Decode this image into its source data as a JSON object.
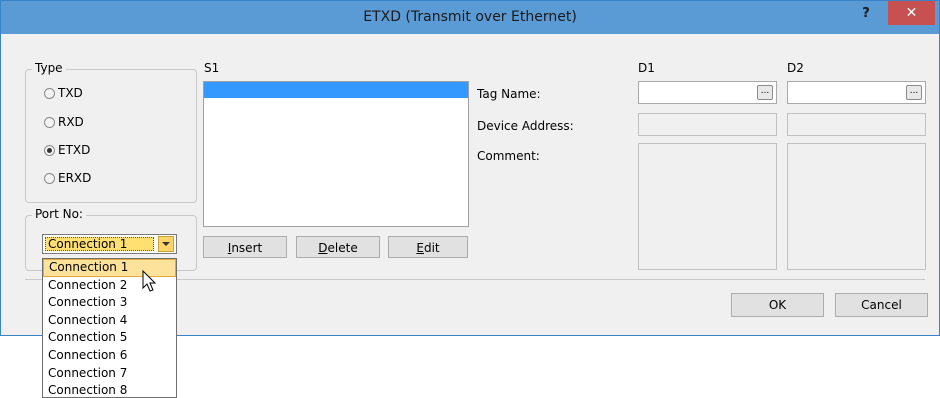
{
  "title": "ETXD (Transmit over Ethernet)",
  "help_label": "?",
  "close_label": "✕",
  "type_group": {
    "label": "Type",
    "options": [
      "TXD",
      "RXD",
      "ETXD",
      "ERXD"
    ],
    "selected": "ETXD"
  },
  "port_group": {
    "label": "Port No:",
    "selected": "Connection 1"
  },
  "s1": {
    "label": "S1"
  },
  "buttons": {
    "insert_key": "I",
    "insert_rest": "nsert",
    "delete_key": "D",
    "delete_rest": "elete",
    "edit_key": "E",
    "edit_rest": "dit",
    "ok": "OK",
    "cancel": "Cancel"
  },
  "fields": {
    "tag_name": "Tag Name:",
    "device_address": "Device Address:",
    "comment": "Comment:",
    "d1": "D1",
    "d2": "D2",
    "browse": "..."
  },
  "dropdown": {
    "items": [
      "Connection 1",
      "Connection 2",
      "Connection 3",
      "Connection 4",
      "Connection 5",
      "Connection 6",
      "Connection 7",
      "Connection 8"
    ],
    "highlighted": "Connection 1"
  }
}
